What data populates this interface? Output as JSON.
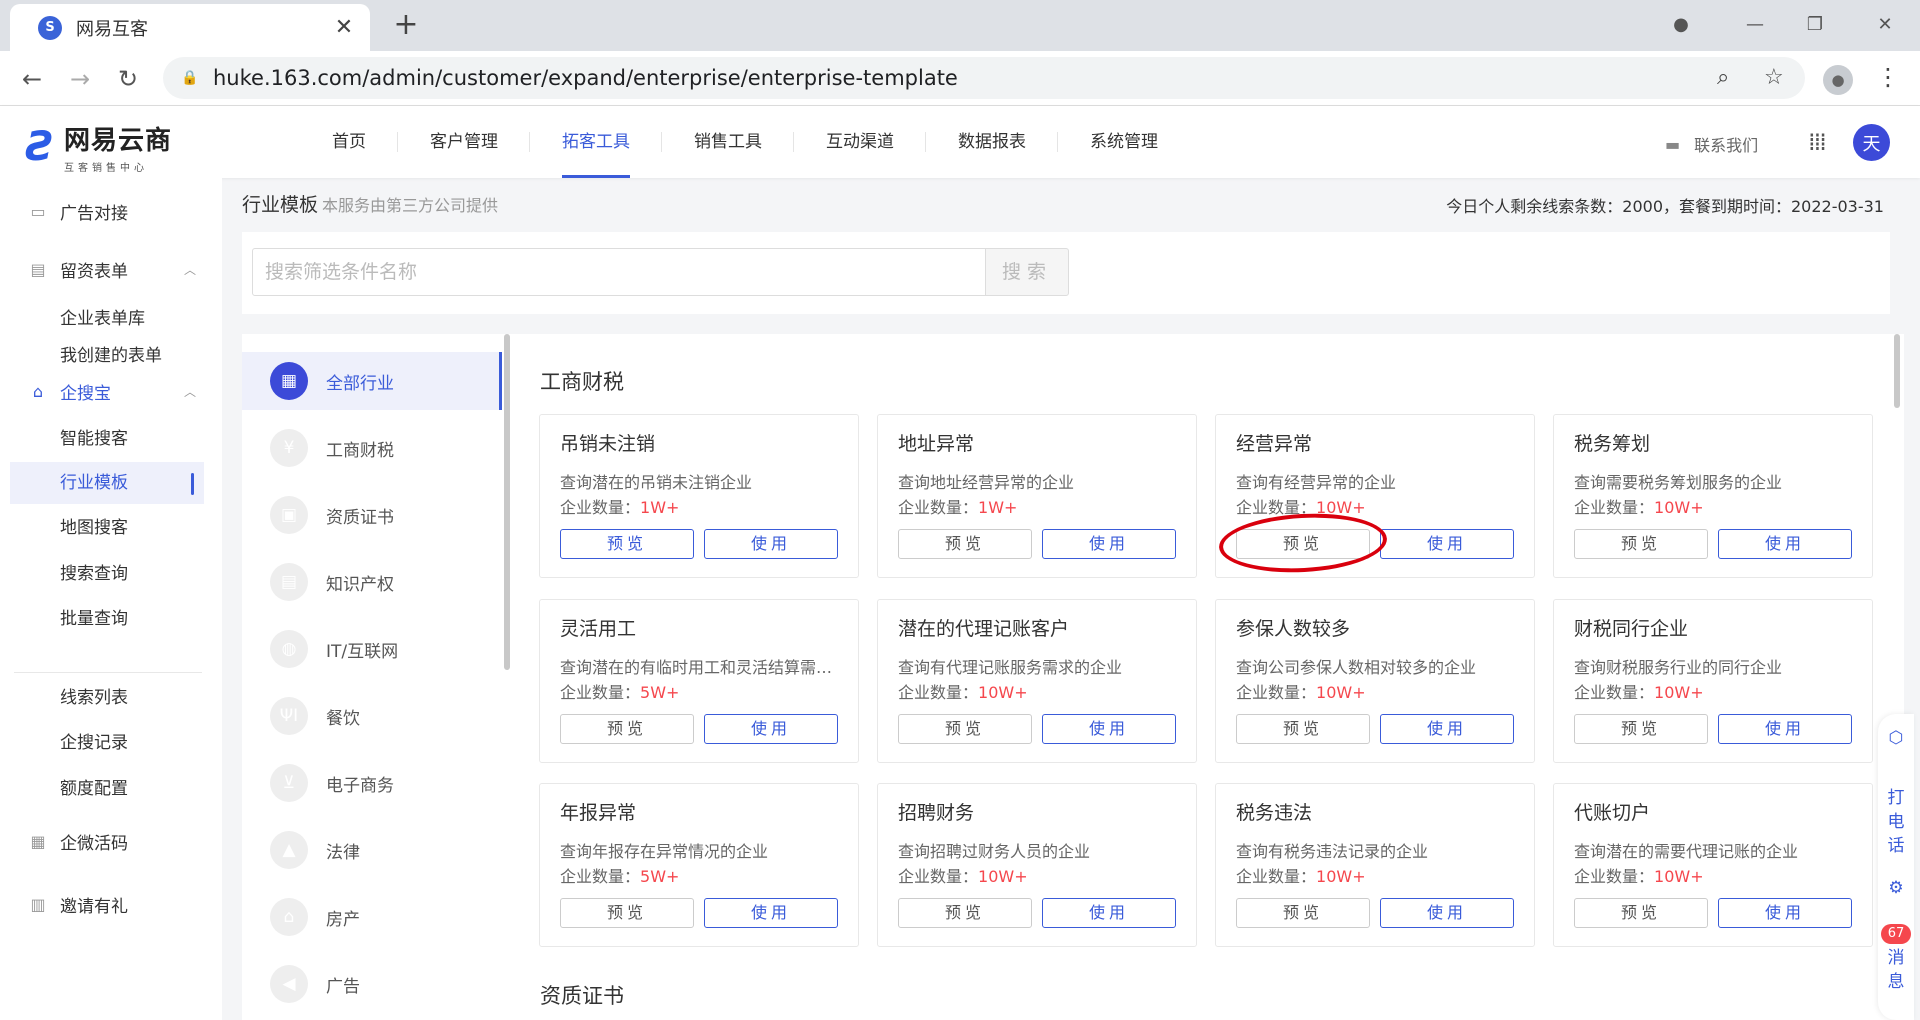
{
  "browser": {
    "tab_title": "网易互客",
    "url": "huke.163.com/admin/customer/expand/enterprise/enterprise-template"
  },
  "header": {
    "logo_main": "网易云商",
    "logo_sub": "互客销售中心",
    "nav": [
      {
        "label": "首页"
      },
      {
        "label": "客户管理"
      },
      {
        "label": "拓客工具"
      },
      {
        "label": "销售工具"
      },
      {
        "label": "互动渠道"
      },
      {
        "label": "数据报表"
      },
      {
        "label": "系统管理"
      }
    ],
    "active_nav": "拓客工具",
    "contact": "联系我们",
    "user_initial": "天"
  },
  "sidebar": {
    "groups": [
      {
        "label": "广告对接",
        "items": []
      },
      {
        "label": "留资表单",
        "items": [
          "企业表单库",
          "我创建的表单"
        ]
      },
      {
        "label": "企搜宝",
        "items": [
          "智能搜客",
          "行业模板",
          "地图搜客",
          "搜索查询",
          "批量查询",
          "线索列表",
          "企搜记录",
          "额度配置"
        ]
      },
      {
        "label": "企微活码",
        "items": []
      },
      {
        "label": "邀请有礼",
        "items": []
      }
    ],
    "active_item": "行业模板"
  },
  "page": {
    "title": "行业模板",
    "note": "本服务由第三方公司提供",
    "quota_text": "今日个人剩余线索条数：2000，套餐到期时间：2022-03-31"
  },
  "search": {
    "placeholder": "搜索筛选条件名称",
    "button": "搜索"
  },
  "categories": [
    {
      "label": "全部行业",
      "icon": "grid-icon",
      "glyph": "▦"
    },
    {
      "label": "工商财税",
      "icon": "yen-icon",
      "glyph": "¥"
    },
    {
      "label": "资质证书",
      "icon": "certificate-icon",
      "glyph": "▣"
    },
    {
      "label": "知识产权",
      "icon": "book-icon",
      "glyph": "▤"
    },
    {
      "label": "IT/互联网",
      "icon": "globe-icon",
      "glyph": "◍"
    },
    {
      "label": "餐饮",
      "icon": "fork-knife-icon",
      "glyph": "ΨI"
    },
    {
      "label": "电子商务",
      "icon": "cart-icon",
      "glyph": "⊻"
    },
    {
      "label": "法律",
      "icon": "gavel-icon",
      "glyph": "▲"
    },
    {
      "label": "房产",
      "icon": "house-icon",
      "glyph": "⌂"
    },
    {
      "label": "广告",
      "icon": "megaphone-icon",
      "glyph": "◀"
    }
  ],
  "active_category": "全部行业",
  "sections": [
    {
      "title": "工商财税",
      "cards": [
        {
          "title": "吊销未注销",
          "desc": "查询潜在的吊销未注销企业",
          "count_label": "企业数量：",
          "count": "1W+"
        },
        {
          "title": "地址异常",
          "desc": "查询地址经营异常的企业",
          "count_label": "企业数量：",
          "count": "1W+"
        },
        {
          "title": "经营异常",
          "desc": "查询有经营异常的企业",
          "count_label": "企业数量：",
          "count": "10W+"
        },
        {
          "title": "税务筹划",
          "desc": "查询需要税务筹划服务的企业",
          "count_label": "企业数量：",
          "count": "10W+"
        },
        {
          "title": "灵活用工",
          "desc": "查询潜在的有临时用工和灵活结算需求的企业",
          "count_label": "企业数量：",
          "count": "5W+"
        },
        {
          "title": "潜在的代理记账客户",
          "desc": "查询有代理记账服务需求的企业",
          "count_label": "企业数量：",
          "count": "10W+"
        },
        {
          "title": "参保人数较多",
          "desc": "查询公司参保人数相对较多的企业",
          "count_label": "企业数量：",
          "count": "10W+"
        },
        {
          "title": "财税同行企业",
          "desc": "查询财税服务行业的同行企业",
          "count_label": "企业数量：",
          "count": "10W+"
        },
        {
          "title": "年报异常",
          "desc": "查询年报存在异常情况的企业",
          "count_label": "企业数量：",
          "count": "5W+"
        },
        {
          "title": "招聘财务",
          "desc": "查询招聘过财务人员的企业",
          "count_label": "企业数量：",
          "count": "10W+"
        },
        {
          "title": "税务违法",
          "desc": "查询有税务违法记录的企业",
          "count_label": "企业数量：",
          "count": "10W+"
        },
        {
          "title": "代账切户",
          "desc": "查询潜在的需要代理记账的企业",
          "count_label": "企业数量：",
          "count": "10W+"
        }
      ]
    },
    {
      "title": "资质证书",
      "cards": []
    }
  ],
  "card_buttons": {
    "preview": "预览",
    "use": "使用"
  },
  "float_bar": {
    "call": "打电话",
    "message": "消息",
    "badge": "67"
  },
  "colors": {
    "accent": "#3a5bd9",
    "danger": "#f5474d",
    "annotation": "#d9000d"
  }
}
